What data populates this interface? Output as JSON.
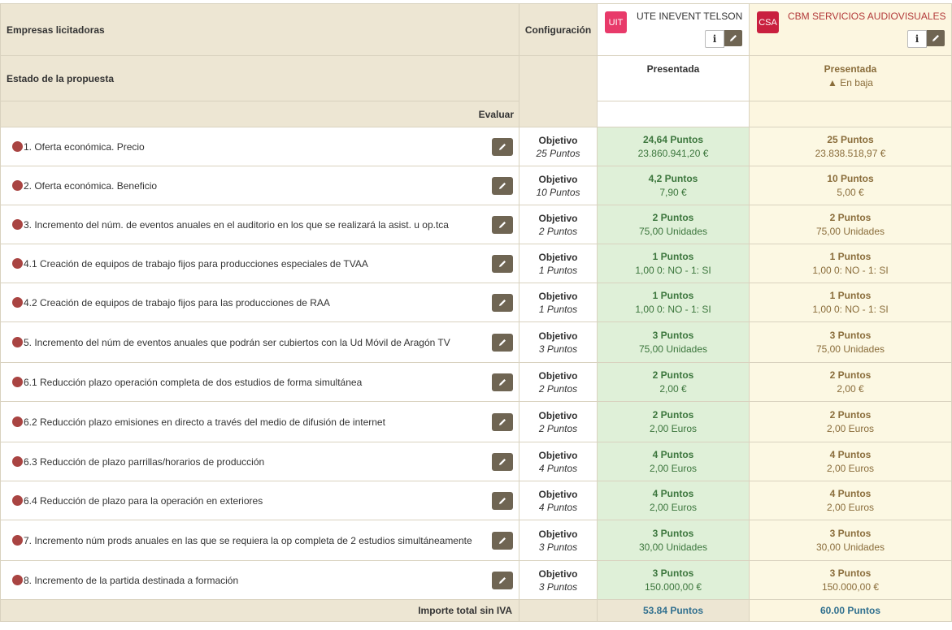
{
  "header": {
    "companies_label": "Empresas licitadoras",
    "config_label": "Configuración",
    "state_label": "Estado de la propuesta",
    "evaluate_label": "Evaluar"
  },
  "companies": [
    {
      "logo": "UIT",
      "name": "UTE INEVENT TELSON",
      "status": "Presentada",
      "note": "",
      "logo_color": "#e83a6a"
    },
    {
      "logo": "CSA",
      "name": "CBM SERVICIOS AUDIOVISUALES",
      "status": "Presentada",
      "note": "En baja",
      "logo_color": "#c9203f"
    }
  ],
  "icons": {
    "info": "info-icon",
    "edit": "pencil-icon",
    "warning": "warning-icon",
    "status_dot": "circle-icon"
  },
  "criteria": [
    {
      "label": "1. Oferta económica. Precio",
      "type": "Objetivo",
      "max": "25 Puntos",
      "c1_pts": "24,64 Puntos",
      "c1_val": "23.860.941,20 €",
      "c2_pts": "25 Puntos",
      "c2_val": "23.838.518,97 €"
    },
    {
      "label": "2. Oferta económica. Beneficio",
      "type": "Objetivo",
      "max": "10 Puntos",
      "c1_pts": "4,2 Puntos",
      "c1_val": "7,90 €",
      "c2_pts": "10 Puntos",
      "c2_val": "5,00 €"
    },
    {
      "label": "3. Incremento del núm. de eventos anuales en el auditorio en los que se realizará la asist. u op.tca",
      "type": "Objetivo",
      "max": "2 Puntos",
      "c1_pts": "2 Puntos",
      "c1_val": "75,00 Unidades",
      "c2_pts": "2 Puntos",
      "c2_val": "75,00 Unidades"
    },
    {
      "label": "4.1 Creación de equipos de trabajo fijos para producciones especiales de TVAA",
      "type": "Objetivo",
      "max": "1 Puntos",
      "c1_pts": "1 Puntos",
      "c1_val": "1,00 0: NO - 1: SI",
      "c2_pts": "1 Puntos",
      "c2_val": "1,00 0: NO - 1: SI"
    },
    {
      "label": "4.2 Creación de equipos de trabajo fijos para las producciones de RAA",
      "type": "Objetivo",
      "max": "1 Puntos",
      "c1_pts": "1 Puntos",
      "c1_val": "1,00 0: NO - 1: SI",
      "c2_pts": "1 Puntos",
      "c2_val": "1,00 0: NO - 1: SI"
    },
    {
      "label": "5. Incremento del núm de eventos anuales que podrán ser cubiertos con la Ud Móvil de Aragón TV",
      "type": "Objetivo",
      "max": "3 Puntos",
      "c1_pts": "3 Puntos",
      "c1_val": "75,00 Unidades",
      "c2_pts": "3 Puntos",
      "c2_val": "75,00 Unidades"
    },
    {
      "label": "6.1 Reducción plazo operación completa de dos estudios de forma simultánea",
      "type": "Objetivo",
      "max": "2 Puntos",
      "c1_pts": "2 Puntos",
      "c1_val": "2,00 €",
      "c2_pts": "2 Puntos",
      "c2_val": "2,00 €"
    },
    {
      "label": "6.2 Reducción plazo emisiones en directo a través del medio de difusión de internet",
      "type": "Objetivo",
      "max": "2 Puntos",
      "c1_pts": "2 Puntos",
      "c1_val": "2,00 Euros",
      "c2_pts": "2 Puntos",
      "c2_val": "2,00 Euros"
    },
    {
      "label": "6.3 Reducción de plazo parrillas/horarios de producción",
      "type": "Objetivo",
      "max": "4 Puntos",
      "c1_pts": "4 Puntos",
      "c1_val": "2,00 Euros",
      "c2_pts": "4 Puntos",
      "c2_val": "2,00 Euros"
    },
    {
      "label": "6.4 Reducción de plazo para la operación en exteriores",
      "type": "Objetivo",
      "max": "4 Puntos",
      "c1_pts": "4 Puntos",
      "c1_val": "2,00 Euros",
      "c2_pts": "4 Puntos",
      "c2_val": "2,00 Euros"
    },
    {
      "label": "7. Incremento núm prods anuales en las que se requiera la op completa de 2 estudios simultáneamente",
      "type": "Objetivo",
      "max": "3 Puntos",
      "c1_pts": "3 Puntos",
      "c1_val": "30,00 Unidades",
      "c2_pts": "3 Puntos",
      "c2_val": "30,00 Unidades"
    },
    {
      "label": "8. Incremento de la partida destinada a formación",
      "type": "Objetivo",
      "max": "3 Puntos",
      "c1_pts": "3 Puntos",
      "c1_val": "150.000,00 €",
      "c2_pts": "3 Puntos",
      "c2_val": "150.000,00 €"
    }
  ],
  "footer": {
    "total_label": "Importe total sin IVA",
    "c1_total": "53.84 Puntos",
    "c2_total": "60.00 Puntos"
  },
  "colors": {
    "header_bg": "#ede6d3",
    "score_green": "#dff0d8",
    "score_cream": "#fcf8e3",
    "status_dot": "#a94442",
    "edit_button": "#6f6553",
    "total_text": "#31708f"
  }
}
